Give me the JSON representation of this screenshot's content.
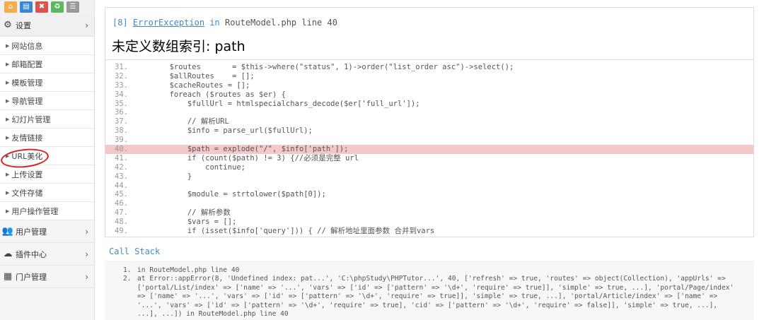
{
  "toolbar": {
    "icons": [
      {
        "name": "home-icon",
        "glyph": "⌂",
        "color": "#f0ad4e"
      },
      {
        "name": "document-icon",
        "glyph": "▤",
        "color": "#3a87d6"
      },
      {
        "name": "trash-icon",
        "glyph": "✖",
        "color": "#d9534f"
      },
      {
        "name": "recycle-icon",
        "glyph": "♻",
        "color": "#5cb85c"
      },
      {
        "name": "list-icon",
        "glyph": "☰",
        "color": "#999999"
      }
    ]
  },
  "sidebar": {
    "settings_label": "设置",
    "settings_items": [
      "网站信息",
      "邮箱配置",
      "模板管理",
      "导航管理",
      "幻灯片管理",
      "友情链接",
      "URL美化",
      "上传设置",
      "文件存储",
      "用户操作管理"
    ],
    "groups": [
      {
        "label": "用户管理",
        "icon": "users-icon"
      },
      {
        "label": "插件中心",
        "icon": "cloud-icon"
      },
      {
        "label": "门户管理",
        "icon": "grid-icon"
      }
    ]
  },
  "exception": {
    "code": "[8]",
    "class_name": "ErrorException",
    "in_text": "in",
    "file": "RouteModel.php line 40",
    "message": "未定义数组索引: path"
  },
  "source": {
    "highlight_line": 40,
    "lines": [
      {
        "n": "31.",
        "text": "        $routes       = $this->where(\"status\", 1)->order(\"list_order asc\")->select();"
      },
      {
        "n": "32.",
        "text": "        $allRoutes    = [];"
      },
      {
        "n": "33.",
        "text": "        $cacheRoutes = [];"
      },
      {
        "n": "34.",
        "text": "        foreach ($routes as $er) {"
      },
      {
        "n": "35.",
        "text": "            $fullUrl = htmlspecialchars_decode($er['full_url']);"
      },
      {
        "n": "36.",
        "text": ""
      },
      {
        "n": "37.",
        "text": "            // 解析URL"
      },
      {
        "n": "38.",
        "text": "            $info = parse_url($fullUrl);"
      },
      {
        "n": "39.",
        "text": ""
      },
      {
        "n": "40.",
        "text": "            $path = explode(\"/\", $info['path']);"
      },
      {
        "n": "41.",
        "text": "            if (count($path) != 3) {//必须是完整 url"
      },
      {
        "n": "42.",
        "text": "                continue;"
      },
      {
        "n": "43.",
        "text": "            }"
      },
      {
        "n": "44.",
        "text": ""
      },
      {
        "n": "45.",
        "text": "            $module = strtolower($path[0]);"
      },
      {
        "n": "46.",
        "text": ""
      },
      {
        "n": "47.",
        "text": "            // 解析参数"
      },
      {
        "n": "48.",
        "text": "            $vars = [];"
      },
      {
        "n": "49.",
        "text": "            if (isset($info['query'])) { // 解析地址里面参数 合并到vars"
      }
    ]
  },
  "call_stack": {
    "title": "Call Stack",
    "items": [
      {
        "num": "1.",
        "text": "in RouteModel.php line 40"
      },
      {
        "num": "2.",
        "text": "at Error::appError(8, 'Undefined index: pat...', 'C:\\phpStudy\\PHPTutor...', 40, ['refresh' => true, 'routes' => object(Collection), 'appUrls' => ['portal/List/index' => ['name' => '...', 'vars' => ['id' => ['pattern' => '\\d+', 'require' => true]], 'simple' => true, ...], 'portal/Page/index' => ['name' => '...', 'vars' => ['id' => ['pattern' => '\\d+', 'require' => true]], 'simple' => true, ...], 'portal/Article/index' => ['name' => '...', 'vars' => ['id' => ['pattern' => '\\d+', 'require' => true], 'cid' => ['pattern' => '\\d+', 'require' => false]], 'simple' => true, ...], ...], ...]) in RouteModel.php line 40"
      }
    ]
  }
}
